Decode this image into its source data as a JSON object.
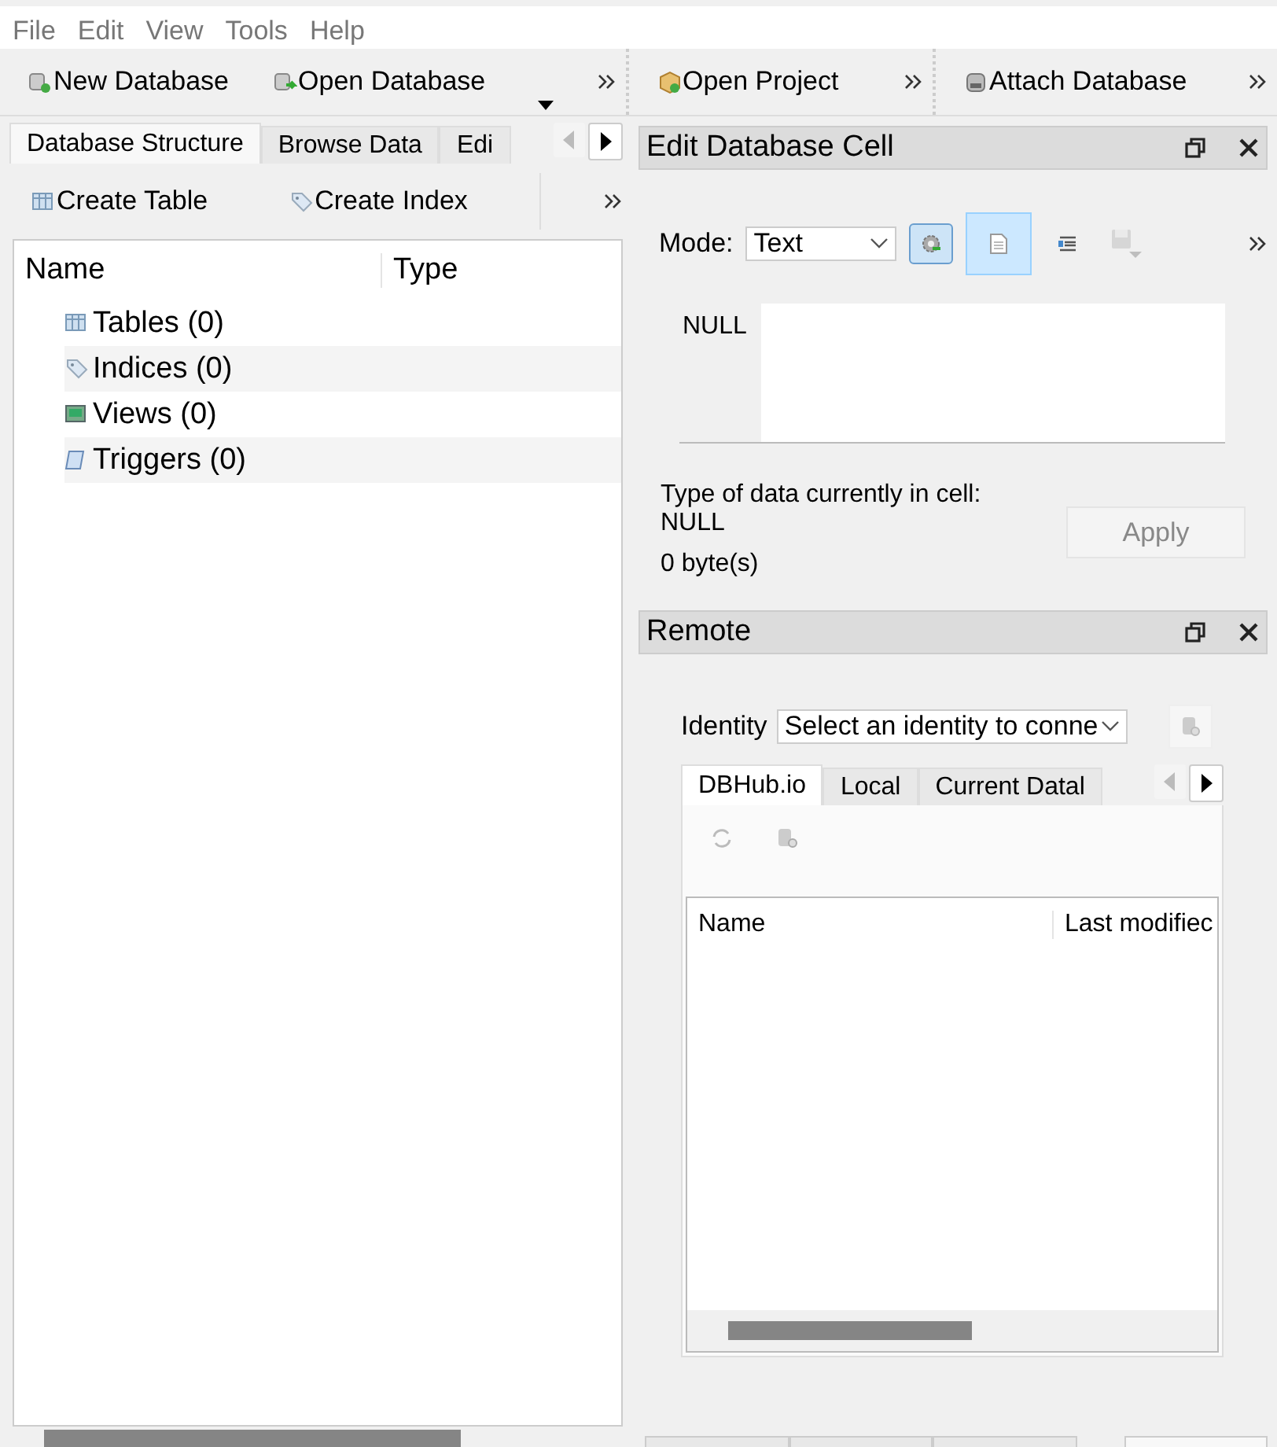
{
  "menu": [
    "File",
    "Edit",
    "View",
    "Tools",
    "Help"
  ],
  "toolbars": [
    {
      "items": [
        {
          "label": "New Database",
          "kind": "new-db",
          "dropdown": false
        },
        {
          "label": "Open Database",
          "kind": "open-db",
          "dropdown": true
        }
      ]
    },
    {
      "items": [
        {
          "label": "Open Project",
          "kind": "project",
          "dropdown": false
        }
      ]
    },
    {
      "items": [
        {
          "label": "Attach Database",
          "kind": "attach",
          "dropdown": false
        }
      ]
    }
  ],
  "left_tabs": [
    {
      "label": "Database Structure",
      "selected": true
    },
    {
      "label": "Browse Data",
      "selected": false
    },
    {
      "label": "Edi",
      "selected": false
    }
  ],
  "structure_toolbar": [
    {
      "label": "Create Table",
      "kind": "table"
    },
    {
      "label": "Create Index",
      "kind": "index"
    }
  ],
  "tree": {
    "columns": [
      "Name",
      "Type"
    ],
    "items": [
      {
        "label": "Tables (0)",
        "kind": "table"
      },
      {
        "label": "Indices (0)",
        "kind": "index"
      },
      {
        "label": "Views (0)",
        "kind": "view"
      },
      {
        "label": "Triggers (0)",
        "kind": "trigger"
      }
    ]
  },
  "edit_cell": {
    "title": "Edit Database Cell",
    "mode_label": "Mode:",
    "mode_value": "Text",
    "tool_buttons": [
      {
        "kind": "auto-format",
        "selected": false,
        "focused": true,
        "disabled": false
      },
      {
        "kind": "text-view",
        "selected": true,
        "focused": false,
        "disabled": false
      },
      {
        "kind": "indent",
        "selected": false,
        "focused": false,
        "disabled": false
      },
      {
        "kind": "save",
        "selected": false,
        "focused": false,
        "disabled": true
      }
    ],
    "null_label": "NULL",
    "type_label": "Type of data currently in cell:",
    "type_value": "NULL",
    "size": "0 byte(s)",
    "apply": {
      "label": "Apply",
      "disabled": true
    }
  },
  "remote": {
    "title": "Remote",
    "identity_label": "Identity",
    "identity_value": "Select an identity to conne",
    "tabs": [
      {
        "label": "DBHub.io",
        "selected": true
      },
      {
        "label": "Local",
        "selected": false
      },
      {
        "label": "Current Datal",
        "selected": false
      }
    ],
    "columns": [
      "Name",
      "Last modifiec"
    ]
  }
}
